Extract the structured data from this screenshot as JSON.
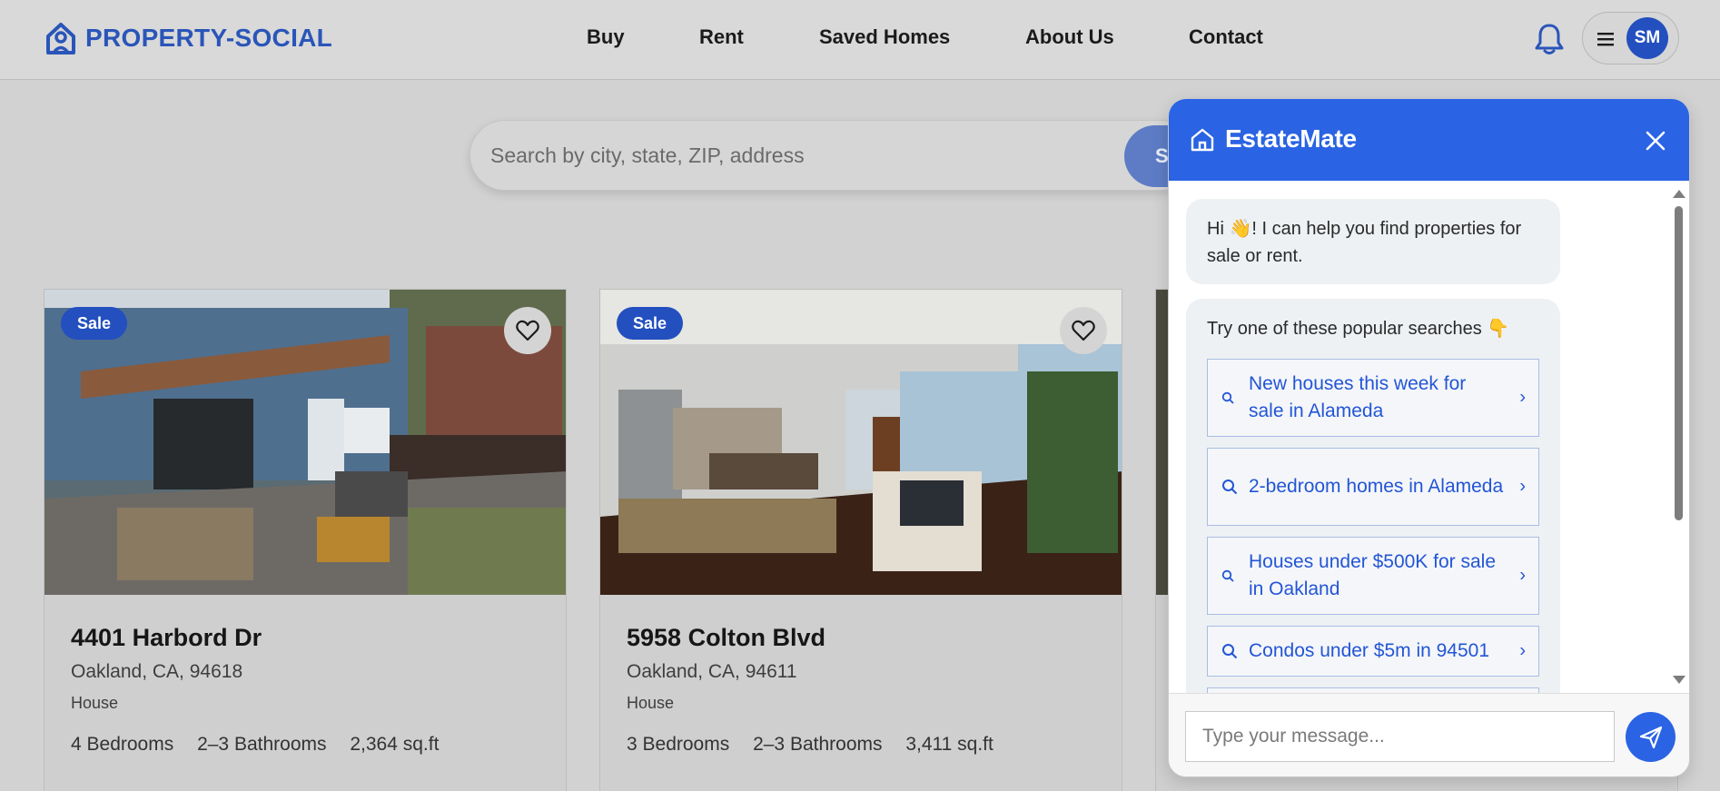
{
  "brand": {
    "name": "PROPERTY-SOCIAL",
    "color": "#2a55b9"
  },
  "nav": {
    "items": [
      "Buy",
      "Rent",
      "Saved Homes",
      "About Us",
      "Contact"
    ]
  },
  "user": {
    "initials": "SM"
  },
  "icons": {
    "notifications": "bell-icon",
    "menu": "hamburger-icon",
    "favorite": "heart-icon",
    "search": "magnifier-icon",
    "send": "paper-plane-icon",
    "close": "close-icon",
    "chat_brand": "house-icon"
  },
  "search": {
    "placeholder": "Search by city, state, ZIP, address",
    "button_label": "Search"
  },
  "listings": [
    {
      "badge": "Sale",
      "address": "4401 Harbord Dr",
      "city": "Oakland, CA, 94618",
      "type": "House",
      "bedrooms": "4 Bedrooms",
      "bathrooms": "2–3 Bathrooms",
      "area": "2,364 sq.ft"
    },
    {
      "badge": "Sale",
      "address": "5958 Colton Blvd",
      "city": "Oakland, CA, 94611",
      "type": "House",
      "bedrooms": "3 Bedrooms",
      "bathrooms": "2–3 Bathrooms",
      "area": "3,411 sq.ft"
    }
  ],
  "chat": {
    "title": "EstateMate",
    "greeting": "Hi 👋! I can help you find properties for sale or rent.",
    "popular_intro": "Try one of these popular searches 👇",
    "suggestions": [
      "New houses this week for sale in Alameda",
      "2-bedroom homes in Alameda",
      "Houses under $500K for sale in Oakland",
      "Condos under $5m in 94501"
    ],
    "input_placeholder": "Type your message...",
    "accent_color": "#2a63e3"
  }
}
